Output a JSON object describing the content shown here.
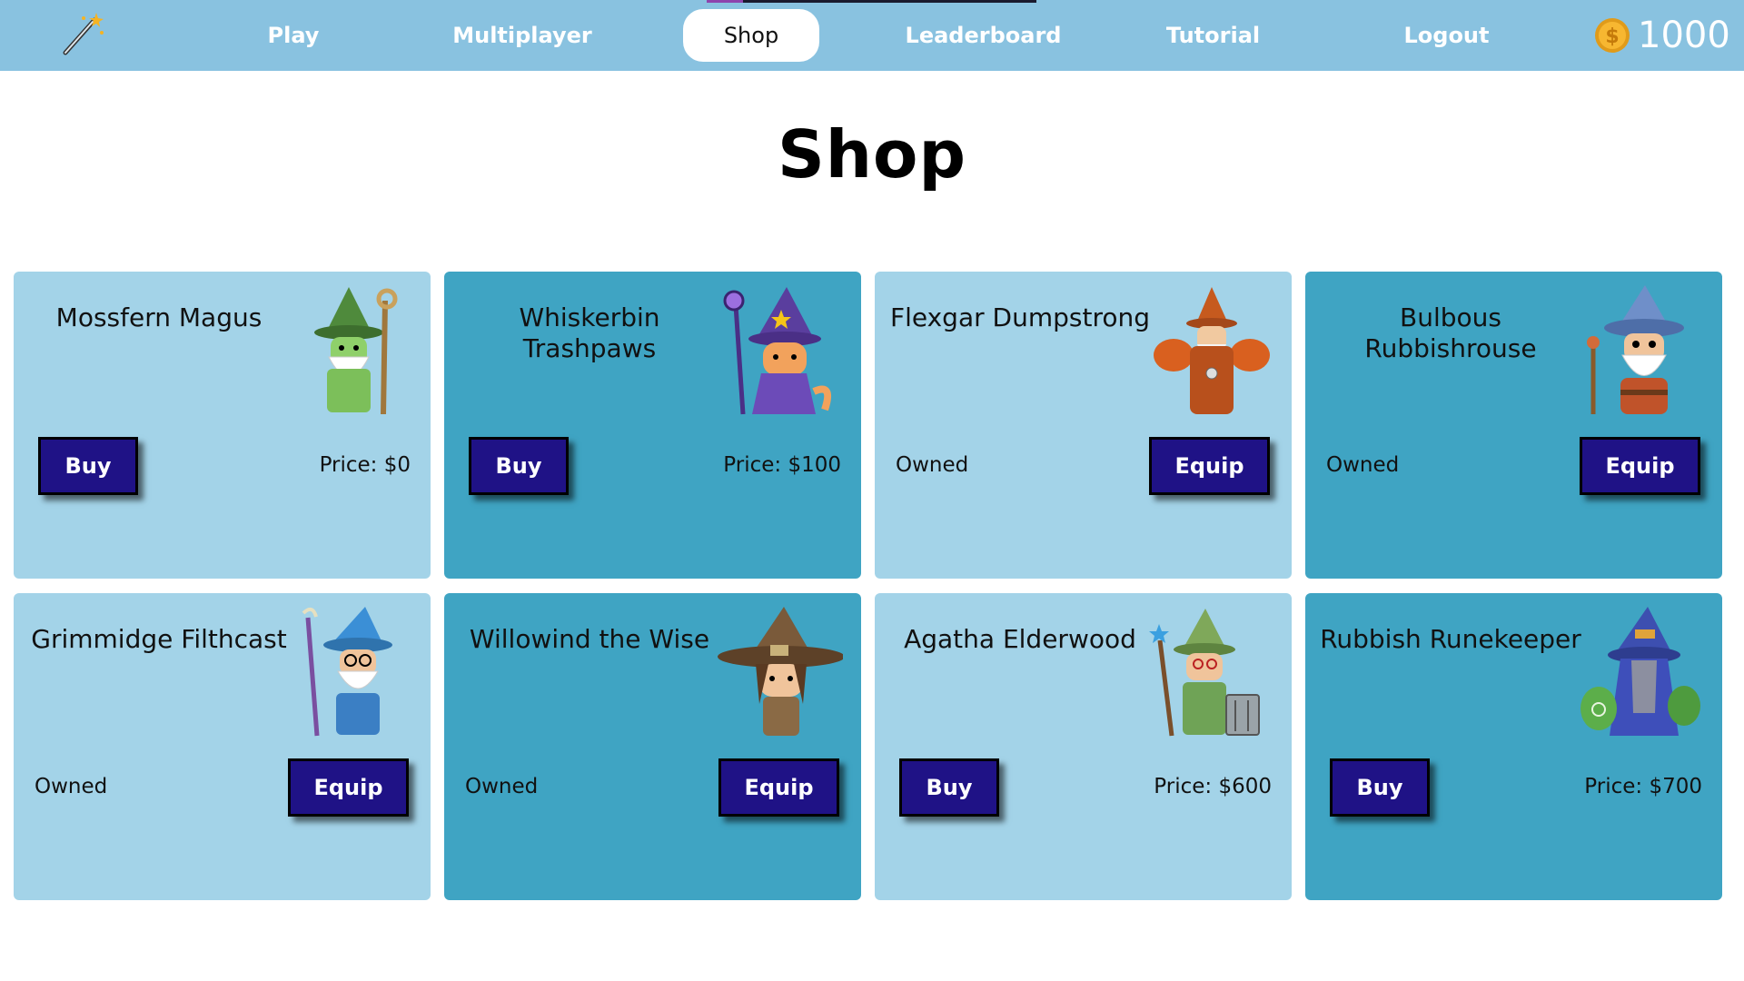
{
  "nav": {
    "logo_icon": "magic-wand-icon",
    "items": [
      {
        "label": "Play"
      },
      {
        "label": "Multiplayer"
      },
      {
        "label": "Shop",
        "active": true
      },
      {
        "label": "Leaderboard"
      },
      {
        "label": "Tutorial"
      },
      {
        "label": "Logout"
      }
    ],
    "coin_icon": "gold-coin-icon",
    "coins": "1000"
  },
  "page": {
    "title": "Shop"
  },
  "shop": {
    "items": [
      {
        "name": "Mossfern Magus",
        "status": "Price: $0",
        "button": "Buy",
        "art": "green-wizard-icon"
      },
      {
        "name": "Whiskerbin Trashpaws",
        "status": "Price: $100",
        "button": "Buy",
        "art": "cat-wizard-icon"
      },
      {
        "name": "Flexgar Dumpstrong",
        "status": "Owned",
        "button": "Equip",
        "art": "muscle-wizard-icon"
      },
      {
        "name": "Bulbous Rubbishrouse",
        "status": "Owned",
        "button": "Equip",
        "art": "gnome-wizard-icon"
      },
      {
        "name": "Grimmidge Filthcast",
        "status": "Owned",
        "button": "Equip",
        "art": "blue-wizard-icon"
      },
      {
        "name": "Willowind the Wise",
        "status": "Owned",
        "button": "Equip",
        "art": "ranger-wizard-icon"
      },
      {
        "name": "Agatha Elderwood",
        "status": "Price: $600",
        "button": "Buy",
        "art": "witch-trashcan-icon"
      },
      {
        "name": "Rubbish Runekeeper",
        "status": "Price: $700",
        "button": "Buy",
        "art": "hooded-wizard-icon"
      }
    ]
  },
  "colors": {
    "navbar": "#89c2e0",
    "card_light": "#a3d3e8",
    "card_dark": "#3fa4c3",
    "button": "#1f1286"
  }
}
